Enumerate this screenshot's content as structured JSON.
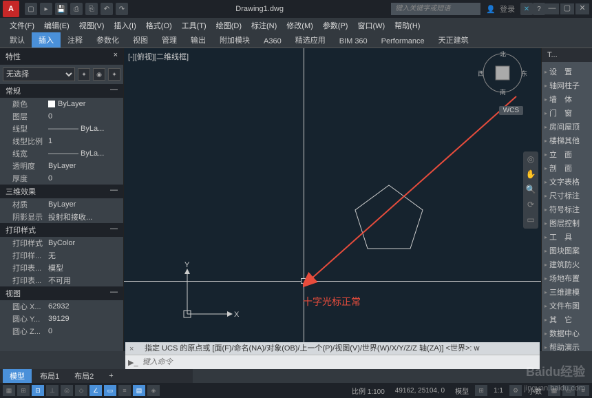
{
  "title": "Drawing1.dwg",
  "search_placeholder": "键入关键字或短语",
  "login": "登录",
  "menus": [
    "文件(F)",
    "编辑(E)",
    "视图(V)",
    "插入(I)",
    "格式(O)",
    "工具(T)",
    "绘图(D)",
    "标注(N)",
    "修改(M)",
    "参数(P)",
    "窗口(W)",
    "帮助(H)"
  ],
  "ribbon_tabs": [
    "默认",
    "插入",
    "注释",
    "参数化",
    "视图",
    "管理",
    "输出",
    "附加模块",
    "A360",
    "精选应用",
    "BIM 360",
    "Performance",
    "天正建筑"
  ],
  "ribbon_active": 1,
  "props": {
    "title": "特性",
    "selection": "无选择",
    "groups": [
      {
        "name": "常规",
        "rows": [
          {
            "label": "颜色",
            "value": "ByLayer",
            "swatch": true
          },
          {
            "label": "图层",
            "value": "0"
          },
          {
            "label": "线型",
            "value": "———— ByLa..."
          },
          {
            "label": "线型比例",
            "value": "1"
          },
          {
            "label": "线宽",
            "value": "———— ByLa..."
          },
          {
            "label": "透明度",
            "value": "ByLayer"
          },
          {
            "label": "厚度",
            "value": "0"
          }
        ]
      },
      {
        "name": "三维效果",
        "rows": [
          {
            "label": "材质",
            "value": "ByLayer"
          },
          {
            "label": "阴影显示",
            "value": "投射和接收..."
          }
        ]
      },
      {
        "name": "打印样式",
        "rows": [
          {
            "label": "打印样式",
            "value": "ByColor"
          },
          {
            "label": "打印样...",
            "value": "无"
          },
          {
            "label": "打印表...",
            "value": "模型"
          },
          {
            "label": "打印表...",
            "value": "不可用"
          }
        ]
      },
      {
        "name": "视图",
        "rows": [
          {
            "label": "圆心 X...",
            "value": "62932"
          },
          {
            "label": "圆心 Y...",
            "value": "39129"
          },
          {
            "label": "圆心 Z...",
            "value": "0"
          }
        ]
      }
    ]
  },
  "viewport_label": "[-][俯视][二维线框]",
  "annotation": "十字光标正常",
  "wcs": "WCS",
  "compass": {
    "n": "北",
    "s": "南",
    "e": "东",
    "w": "西"
  },
  "ucs_labels": {
    "x": "X",
    "y": "Y"
  },
  "right_panel": {
    "tab": "T...",
    "items": [
      "设　置",
      "轴网柱子",
      "墙　体",
      "门　窗",
      "房间屋顶",
      "楼梯其他",
      "立　面",
      "剖　面",
      "文字表格",
      "尺寸标注",
      "符号标注",
      "图层控制",
      "工　具",
      "图块图案",
      "建筑防火",
      "场地布置",
      "三维建模",
      "文件布图",
      "其　它",
      "数据中心",
      "帮助演示"
    ]
  },
  "command": {
    "history": "指定 UCS 的原点或 [面(F)/命名(NA)/对象(OB)/上一个(P)/视图(V)/世界(W)/X/Y/Z/Z 轴(ZA)] <世界>: w",
    "placeholder": "键入命令",
    "x": "×"
  },
  "layout_tabs": [
    "模型",
    "布局1",
    "布局2",
    "+"
  ],
  "layout_active": 0,
  "status": {
    "scale": "比例 1:100",
    "coords": "49162, 25104, 0",
    "space": "模型",
    "scale2": "1:1",
    "dec": "小数"
  },
  "watermark": "Baidu经验",
  "watermark_url": "jingyan.baidu.com"
}
